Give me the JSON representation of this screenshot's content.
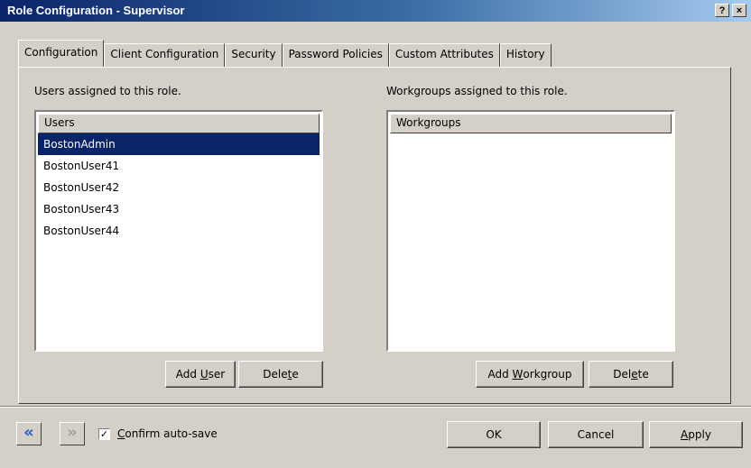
{
  "window": {
    "title": "Role Configuration - Supervisor",
    "help_label": "?",
    "close_label": "×"
  },
  "tabs": [
    {
      "label": "Configuration"
    },
    {
      "label": "Client Configuration"
    },
    {
      "label": "Security"
    },
    {
      "label": "Password Policies"
    },
    {
      "label": "Custom Attributes"
    },
    {
      "label": "History"
    }
  ],
  "users_section": {
    "caption": "Users assigned to this role.",
    "header": "Users",
    "items": [
      "BostonAdmin",
      "BostonUser41",
      "BostonUser42",
      "BostonUser43",
      "BostonUser44"
    ],
    "selected": "BostonAdmin",
    "add_label_pre": "Add ",
    "add_label_u": "U",
    "add_label_post": "ser",
    "delete_label_pre": "Dele",
    "delete_label_u": "t",
    "delete_label_post": "e"
  },
  "workgroups_section": {
    "caption": "Workgroups assigned to this role.",
    "header": "Workgroups",
    "add_label_pre": "Add ",
    "add_label_u": "W",
    "add_label_post": "orkgroup",
    "delete_label_pre": "Del",
    "delete_label_u": "e",
    "delete_label_post": "te"
  },
  "footer": {
    "back_icon": "«",
    "forward_icon": "»",
    "checkbox_checked": true,
    "checkbox_mark": "✓",
    "confirm_label_u": "C",
    "confirm_label_rest": "onfirm auto-save",
    "ok_label": "OK",
    "cancel_label": "Cancel",
    "apply_label_u": "A",
    "apply_label_rest": "pply"
  },
  "colors": {
    "selection": "#0a246a",
    "nav_back": "#1f5fc8",
    "face": "#d4d0c8"
  }
}
